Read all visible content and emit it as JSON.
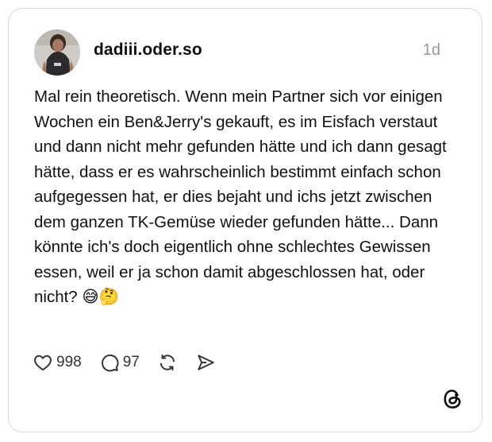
{
  "post": {
    "username": "dadiii.oder.so",
    "timestamp": "1d",
    "text": "Mal rein theoretisch. Wenn mein Partner sich vor einigen Wochen ein Ben&Jerry's gekauft, es im Eisfach verstaut und dann nicht mehr gefunden hätte und ich dann gesagt hätte, dass er es wahrscheinlich bestimmt einfach schon aufgegessen hat, er dies bejaht und ichs jetzt zwischen dem ganzen TK-Gemüse wieder gefunden hätte... Dann könnte ich's doch eigentlich ohne schlechtes Gewissen essen, weil er ja schon damit abgeschlossen hat, oder nicht? 😅🤔"
  },
  "actions": {
    "likes": "998",
    "replies": "97"
  },
  "icons": {
    "like": "heart-icon",
    "reply": "comment-bubble-icon",
    "repost": "repost-icon",
    "share": "send-icon",
    "brand": "threads-logo-icon"
  },
  "colors": {
    "text": "#111111",
    "muted": "#999999",
    "border": "#d9d9d9"
  }
}
